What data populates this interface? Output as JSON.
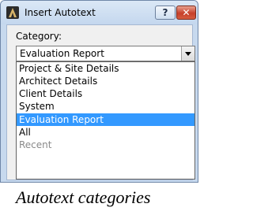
{
  "window": {
    "title": "Insert Autotext",
    "help_label": "?",
    "close_label": "✕"
  },
  "category": {
    "label": "Category:",
    "selected_value": "Evaluation Report",
    "options": [
      {
        "label": "Project & Site Details",
        "state": "normal"
      },
      {
        "label": "Architect Details",
        "state": "normal"
      },
      {
        "label": "Client Details",
        "state": "normal"
      },
      {
        "label": "System",
        "state": "normal"
      },
      {
        "label": "Evaluation Report",
        "state": "selected"
      },
      {
        "label": "All",
        "state": "normal"
      },
      {
        "label": "Recent",
        "state": "disabled"
      }
    ]
  },
  "caption": "Autotext categories",
  "colors": {
    "selection": "#3399ff",
    "titlebar": "#c4d7ee",
    "close_button": "#c7402a"
  },
  "icons": [
    "app-icon",
    "help-icon",
    "close-icon",
    "dropdown-arrow-icon"
  ]
}
